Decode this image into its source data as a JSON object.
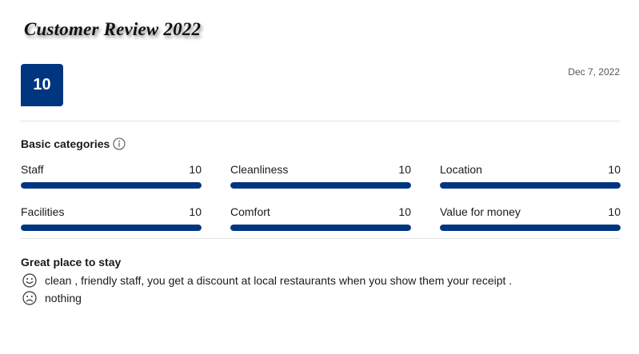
{
  "page": {
    "title": "Customer Review 2022"
  },
  "review": {
    "score": "10",
    "date": "Dec 7, 2022",
    "title": "Great place to stay",
    "positive": "clean , friendly staff, you get a discount at local restaurants when you show them your receipt .",
    "negative": "nothing"
  },
  "categories": {
    "heading": "Basic categories",
    "max_score": 10,
    "items": [
      {
        "label": "Staff",
        "score": "10",
        "fill_fraction": 1.0
      },
      {
        "label": "Cleanliness",
        "score": "10",
        "fill_fraction": 1.0
      },
      {
        "label": "Location",
        "score": "10",
        "fill_fraction": 1.0
      },
      {
        "label": "Facilities",
        "score": "10",
        "fill_fraction": 1.0
      },
      {
        "label": "Comfort",
        "score": "10",
        "fill_fraction": 1.0
      },
      {
        "label": "Value for money",
        "score": "10",
        "fill_fraction": 1.0
      }
    ]
  },
  "icons": {
    "info": "info-icon",
    "positive": "smiley-face-icon",
    "negative": "sad-face-icon"
  },
  "colors": {
    "accent": "#003580",
    "bar_track": "#ebebeb",
    "divider": "#e2e2e2"
  }
}
